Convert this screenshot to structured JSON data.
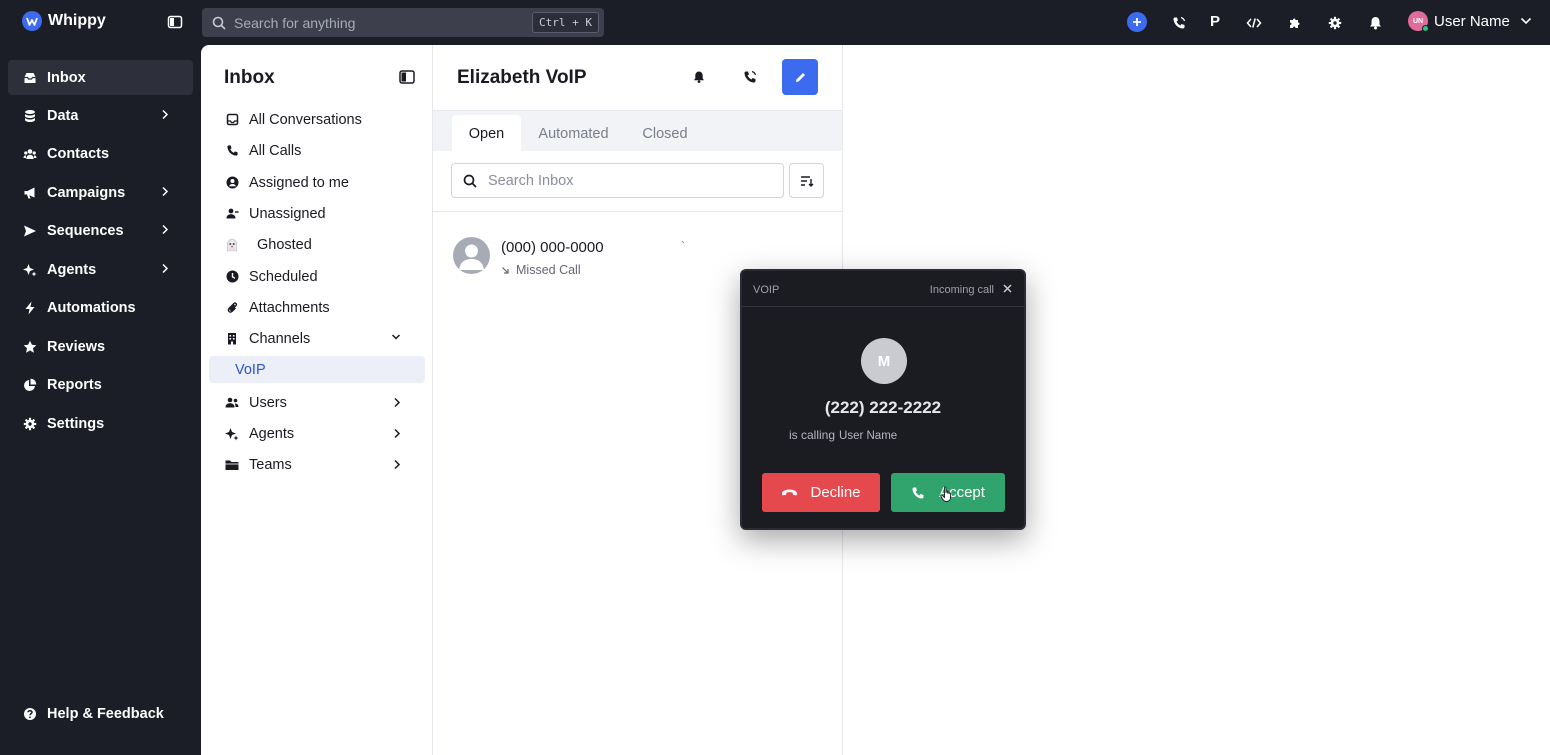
{
  "app": {
    "name": "Whippy"
  },
  "search": {
    "placeholder": "Search for anything",
    "shortcut": "Ctrl + K"
  },
  "user": {
    "name": "User Name",
    "initials": "UN"
  },
  "nav": {
    "items": [
      {
        "label": "Inbox",
        "icon": "inbox-icon",
        "active": true
      },
      {
        "label": "Data",
        "icon": "database-icon",
        "chevron": true
      },
      {
        "label": "Contacts",
        "icon": "contacts-icon"
      },
      {
        "label": "Campaigns",
        "icon": "megaphone-icon",
        "chevron": true
      },
      {
        "label": "Sequences",
        "icon": "send-icon",
        "chevron": true
      },
      {
        "label": "Agents",
        "icon": "sparkle-icon",
        "chevron": true
      },
      {
        "label": "Automations",
        "icon": "bolt-icon"
      },
      {
        "label": "Reviews",
        "icon": "star-icon"
      },
      {
        "label": "Reports",
        "icon": "pie-chart-icon"
      },
      {
        "label": "Settings",
        "icon": "gear-icon"
      }
    ],
    "help": "Help & Feedback"
  },
  "inbox": {
    "title": "Inbox",
    "items": [
      {
        "label": "All Conversations",
        "icon": "inbox-tray-icon"
      },
      {
        "label": "All Calls",
        "icon": "phone-icon"
      },
      {
        "label": "Assigned to me",
        "icon": "user-circle-icon"
      },
      {
        "label": "Unassigned",
        "icon": "user-minus-icon"
      },
      {
        "label": "Ghosted",
        "icon": "ghost-icon"
      },
      {
        "label": "Scheduled",
        "icon": "clock-icon"
      },
      {
        "label": "Attachments",
        "icon": "paperclip-icon"
      },
      {
        "label": "Channels",
        "icon": "building-icon",
        "chevron": "down"
      },
      {
        "label": "VoIP",
        "selected": true
      },
      {
        "label": "Users",
        "icon": "users-icon",
        "chevron": "right"
      },
      {
        "label": "Agents",
        "icon": "sparkle-icon",
        "chevron": "right"
      },
      {
        "label": "Teams",
        "icon": "folder-icon",
        "chevron": "right"
      }
    ]
  },
  "conversations": {
    "title": "Elizabeth VoIP",
    "tabs": [
      "Open",
      "Automated",
      "Closed"
    ],
    "active_tab": "Open",
    "search_placeholder": "Search Inbox",
    "items": [
      {
        "phone": "(000) 000-0000",
        "status": "Missed Call",
        "tick": "`"
      }
    ]
  },
  "voip": {
    "label": "VOIP",
    "status": "Incoming call",
    "caller_initial": "M",
    "caller_number": "(222) 222-2222",
    "calling_text": "is calling",
    "callee": "User Name",
    "decline_label": "Decline",
    "accept_label": "Accept"
  },
  "colors": {
    "accent": "#3d6bf0",
    "decline": "#e5484d",
    "accept": "#30a46c",
    "sidebar": "#1b1d27"
  }
}
